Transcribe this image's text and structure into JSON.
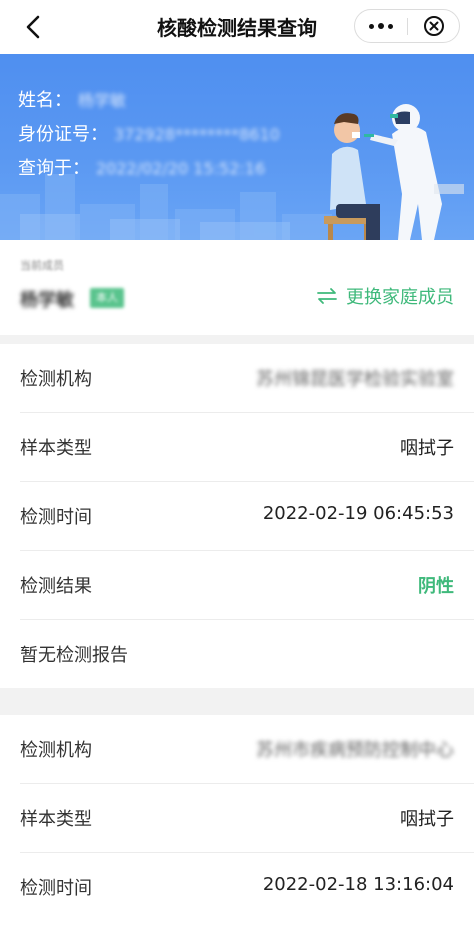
{
  "nav": {
    "title": "核酸检测结果查询",
    "back_icon": "chevron-left-icon",
    "more_icon": "more-dots-icon",
    "close_icon": "close-circle-icon"
  },
  "banner": {
    "name_label": "姓名：",
    "name_value": "杨学敏",
    "id_label": "身份证号：",
    "id_value": "372928********8610",
    "query_label": "查询于：",
    "query_value": "2022/02/20 15:52:16"
  },
  "member": {
    "current_label": "当前成员",
    "name": "杨学敏",
    "tag": "本人",
    "switch_label": "更换家庭成员",
    "switch_icon": "swap-arrows-icon"
  },
  "records": [
    {
      "institution_label": "检测机构",
      "institution_value": "苏州锦昆医学检验实验室",
      "sample_label": "样本类型",
      "sample_value": "咽拭子",
      "time_label": "检测时间",
      "time_value": "2022-02-19 06:45:53",
      "result_label": "检测结果",
      "result_value": "阴性",
      "report_label": "暂无检测报告"
    },
    {
      "institution_label": "检测机构",
      "institution_value": "苏州市疾病预防控制中心",
      "sample_label": "样本类型",
      "sample_value": "咽拭子",
      "time_label": "检测时间",
      "time_value": "2022-02-18 13:16:04"
    }
  ],
  "colors": {
    "accent_green": "#3fb97b",
    "banner_blue": "#5a98f2"
  }
}
